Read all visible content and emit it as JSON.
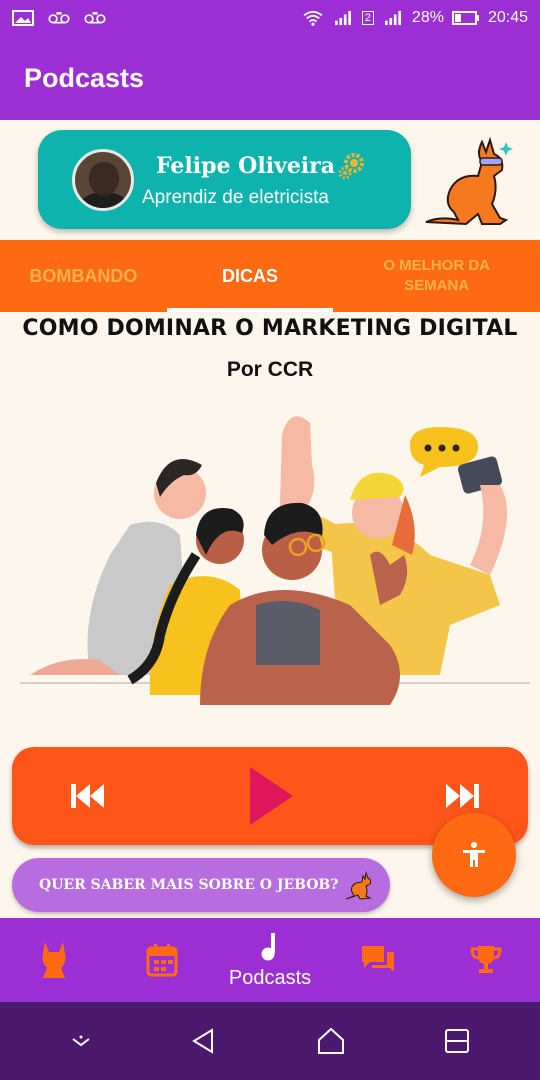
{
  "status_bar": {
    "battery_percent": "28%",
    "time": "20:45",
    "sim_label": "2",
    "colors": {
      "bar": "#9b2fd4"
    }
  },
  "app_bar": {
    "title": "Podcasts"
  },
  "profile": {
    "name": "Felipe Oliveira",
    "role": "Aprendiz de eletricista",
    "icons": [
      "avatar",
      "gear-icon",
      "kangaroo-logo"
    ]
  },
  "tabs": [
    {
      "label": "BOMBANDO",
      "active": false
    },
    {
      "label": "DICAS",
      "active": true
    },
    {
      "label": "O MELHOR DA SEMANA",
      "active": false
    }
  ],
  "podcast": {
    "title": "COMO DOMINAR O MARKETING DIGITAL",
    "author": "Por CCR"
  },
  "player": {
    "icons": [
      "previous-icon",
      "play-icon",
      "next-icon"
    ],
    "colors": {
      "bar": "#ff5518",
      "play": "#e0175a"
    }
  },
  "more_button": {
    "label": "QUER SABER MAIS SOBRE O JEBOB?"
  },
  "bottom_nav": {
    "items": [
      {
        "icon": "kangaroo-icon",
        "label": ""
      },
      {
        "icon": "calendar-icon",
        "label": ""
      },
      {
        "icon": "music-note-icon",
        "label": "Podcasts",
        "active": true
      },
      {
        "icon": "chat-icon",
        "label": ""
      },
      {
        "icon": "trophy-icon",
        "label": ""
      }
    ]
  },
  "colors": {
    "primary": "#9b2fd4",
    "accent": "#ff6a13",
    "teal": "#0fb3ad",
    "background": "#fdf6ec"
  }
}
